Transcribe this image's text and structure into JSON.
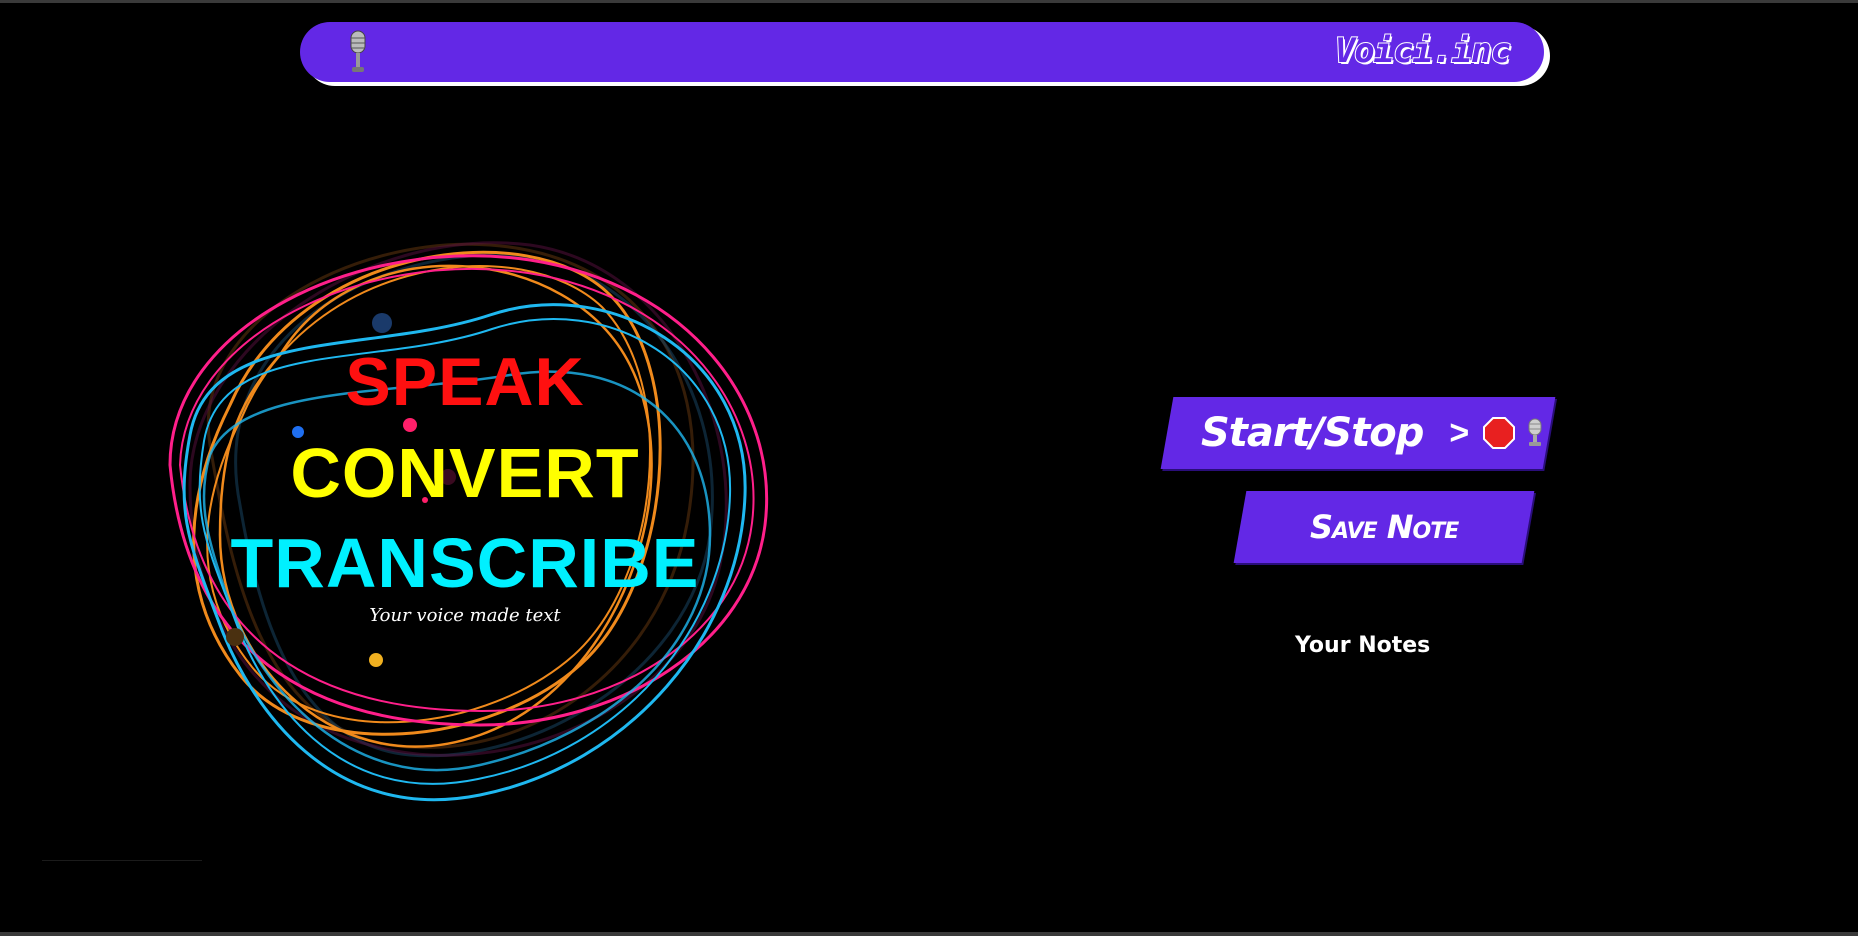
{
  "header": {
    "brand": "Voici.inc",
    "logo_icon": "microphone-icon"
  },
  "hero": {
    "line1": "SPEAK",
    "line2": "CONVERT",
    "line3": "TRANSCRIBE",
    "tagline": "Your voice made text",
    "colors": {
      "line1": "#ff1010",
      "line2": "#ffff00",
      "line3": "#00f0ff"
    }
  },
  "controls": {
    "start_stop_label": "Start/Stop",
    "chevron": ">",
    "stop_icon": "stop-sign-icon",
    "mic_icon": "microphone-icon",
    "save_label": "Save Note"
  },
  "notes": {
    "title": "Your Notes"
  },
  "colors": {
    "accent": "#6328e6",
    "background": "#000000"
  }
}
